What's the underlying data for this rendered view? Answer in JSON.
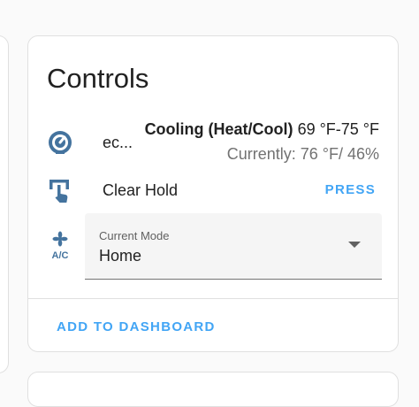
{
  "card": {
    "title": "Controls",
    "add_to_dashboard_label": "ADD TO DASHBOARD"
  },
  "thermostat": {
    "icon": "thermostat-icon",
    "name": "ec...",
    "mode": "Cooling (Heat/Cool)",
    "range": "69 °F-75 °F",
    "current": "Currently: 76 °F/ 46%"
  },
  "hold": {
    "icon": "touch-app-icon",
    "label": "Clear Hold",
    "action_label": "PRESS"
  },
  "mode_select": {
    "icon": "air-conditioner-icon",
    "label": "Current Mode",
    "value": "Home"
  },
  "colors": {
    "accent": "#42a5f5",
    "icon": "#44739e",
    "text": "#212121",
    "secondary_text": "#727272"
  }
}
